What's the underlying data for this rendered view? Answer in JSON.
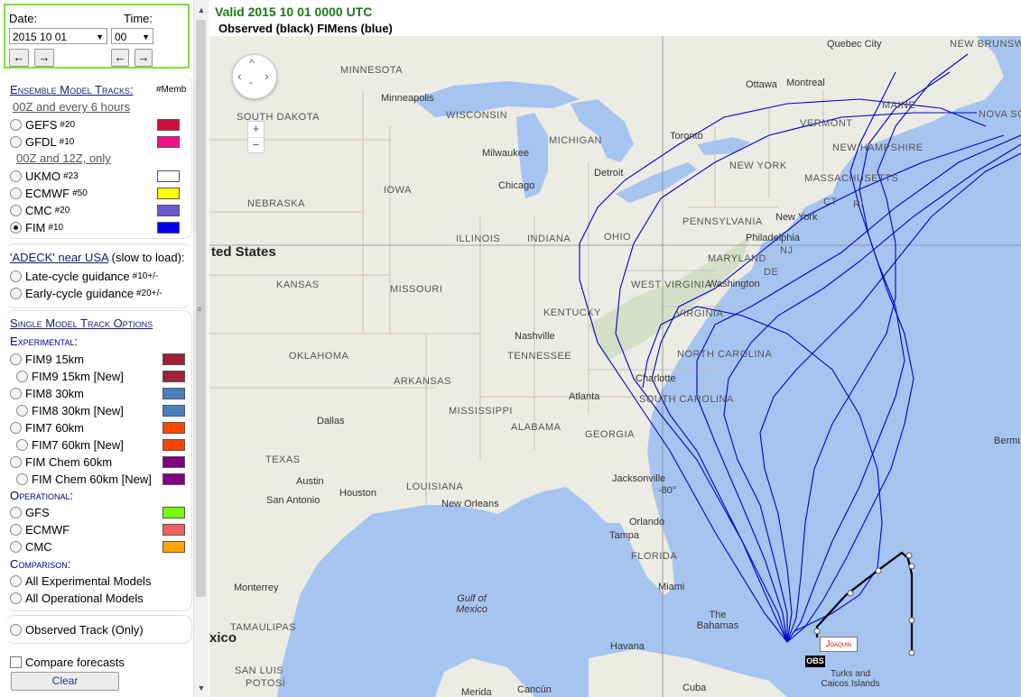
{
  "date_time": {
    "date_label": "Date:",
    "time_label": "Time:",
    "date_value": "2015 10 01",
    "time_value": "00",
    "prev_arrow": "←",
    "next_arrow": "→"
  },
  "ensemble": {
    "title": "Ensemble Model Tracks:",
    "memb_note": "#Memb",
    "group1_label": "00Z and every 6 hours",
    "group2_label": "00Z and 12Z, only",
    "models": [
      {
        "name": "GEFS",
        "count": "#20",
        "color": "#d0103a",
        "selected": false
      },
      {
        "name": "GFDL",
        "count": "#10",
        "color": "#ee1188",
        "selected": false
      },
      {
        "name": "UKMO",
        "count": "#23",
        "color": "#ffffff",
        "selected": false
      },
      {
        "name": "ECMWF",
        "count": "#50",
        "color": "#ffff00",
        "selected": false
      },
      {
        "name": "CMC",
        "count": "#20",
        "color": "#6a5acd",
        "selected": false
      },
      {
        "name": "FIM",
        "count": "#10",
        "color": "#0000ee",
        "selected": true
      }
    ]
  },
  "adeck": {
    "title": "'ADECK' near USA",
    "title_suffix": " (slow to load):",
    "options": [
      {
        "label": "Late-cycle guidance",
        "note": "#10+/-"
      },
      {
        "label": "Early-cycle guidance",
        "note": "#20+/-"
      }
    ]
  },
  "single": {
    "title": "Single Model Track Options",
    "experimental_label": "Experimental:",
    "experimental": [
      {
        "label": "FIM9 15km",
        "color": "#9b2335",
        "indent": false
      },
      {
        "label": "FIM9 15km [New]",
        "color": "#9b2335",
        "indent": true
      },
      {
        "label": "FIM8 30km",
        "color": "#4a7fbf",
        "indent": false
      },
      {
        "label": "FIM8 30km [New]",
        "color": "#4a7fbf",
        "indent": true
      },
      {
        "label": "FIM7 60km",
        "color": "#ff4500",
        "indent": false
      },
      {
        "label": "FIM7 60km [New]",
        "color": "#ff4500",
        "indent": true
      },
      {
        "label": "FIM Chem 60km",
        "color": "#800080",
        "indent": false
      },
      {
        "label": "FIM Chem 60km [New]",
        "color": "#800080",
        "indent": true
      }
    ],
    "operational_label": "Operational:",
    "operational": [
      {
        "label": "GFS",
        "color": "#7cfc00"
      },
      {
        "label": "ECMWF",
        "color": "#f06060"
      },
      {
        "label": "CMC",
        "color": "#ffa500"
      }
    ],
    "comparison_label": "Comparison:",
    "comparison": [
      "All Experimental Models",
      "All Operational Models"
    ]
  },
  "observed": {
    "label": "Observed Track (Only)"
  },
  "compare": {
    "label": "Compare forecasts",
    "checked": false
  },
  "clear_button": "Clear",
  "map": {
    "valid_text": "Valid 2015 10 01 0000 UTC",
    "subtitle": "Observed (black) FIMens (blue)",
    "storm_label": "Joaquin",
    "obs_label": "OBS",
    "zoom_in": "+",
    "zoom_out": "−",
    "track_color": "#0000cc",
    "observed_color": "#000000",
    "labels": {
      "minnesota": "MINNESOTA",
      "minneapolis": "Minneapolis",
      "wisconsin": "WISCONSIN",
      "michigan": "MICHIGAN",
      "south_dakota": "SOUTH DAKOTA",
      "milwaukee": "Milwaukee",
      "detroit": "Detroit",
      "chicago": "Chicago",
      "iowa": "IOWA",
      "nebraska": "NEBRASKA",
      "illinois": "ILLINOIS",
      "indiana": "INDIANA",
      "ohio": "OHIO",
      "united_states": "ted States",
      "kansas": "KANSAS",
      "missouri": "MISSOURI",
      "kentucky": "KENTUCKY",
      "west_virginia": "WEST VIRGINIA",
      "virginia": "VIRGINIA",
      "nashville": "Nashville",
      "tennessee": "TENNESSEE",
      "oklahoma": "OKLAHOMA",
      "arkansas": "ARKANSAS",
      "north_carolina": "NORTH CAROLINA",
      "charlotte": "Charlotte",
      "south_carolina": "SOUTH CAROLINA",
      "atlanta": "Atlanta",
      "mississippi": "MISSISSIPPI",
      "alabama": "ALABAMA",
      "georgia": "GEORGIA",
      "dallas": "Dallas",
      "texas": "TEXAS",
      "austin": "Austin",
      "houston": "Houston",
      "louisiana": "LOUISIANA",
      "new_orleans": "New Orleans",
      "san_antonio": "San Antonio",
      "jacksonville": "Jacksonville",
      "orlando": "Orlando",
      "tampa": "Tampa",
      "florida": "FLORIDA",
      "miami": "Miami",
      "gulf_mexico": "Gulf of Mexico",
      "the_bahamas": "The Bahamas",
      "havana": "Havana",
      "cuba": "Cuba",
      "merida": "Merida",
      "cancun": "Cancún",
      "monterrey": "Monterrey",
      "tamaulipas": "TAMAULIPAS",
      "san_luis": "SAN LUIS",
      "potosi": "POTOSÍ",
      "mexico": "xico",
      "turks": "Turks and Caicos Islands",
      "bermuda": "Bermuda",
      "quebec": "Quebec City",
      "ottawa": "Ottawa",
      "montreal": "Montreal",
      "toronto": "Toronto",
      "new_york_state": "NEW YORK",
      "vermont": "VERMONT",
      "maine": "MAINE",
      "new_hampshire": "NEW HAMPSHIRE",
      "massachusetts": "MASSACHUSETTS",
      "new_york_city": "New York",
      "pennsylvania": "PENNSYLVANIA",
      "philadelphia": "Philadelphia",
      "maryland": "MARYLAND",
      "washington": "Washington",
      "new_brunswick": "NEW BRUNSWICK",
      "nova_scotia": "NOVA SCO",
      "nj": "NJ",
      "de": "DE",
      "ri": "RI",
      "ct": "CT",
      "lon80": "-80°"
    }
  }
}
